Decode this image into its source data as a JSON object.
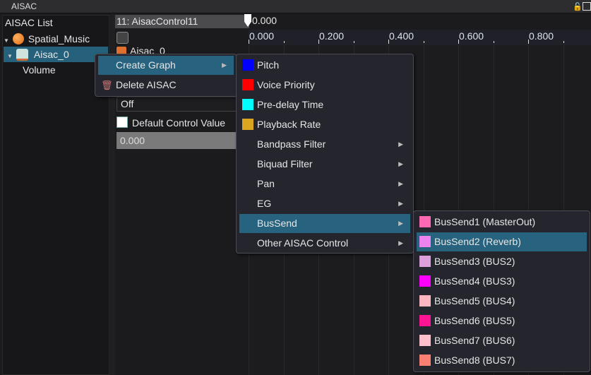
{
  "window": {
    "title": "AISAC"
  },
  "left_panel": {
    "header": "AISAC List",
    "items": [
      {
        "label": "Spatial_Music"
      },
      {
        "label": "Aisac_0"
      },
      {
        "label": "Volume"
      }
    ]
  },
  "control": {
    "name": "11: AisacControl11",
    "value": "0.000",
    "obscured_label": "Aisac_0",
    "mode": "Off",
    "default_label": "Default Control Value",
    "default_value": "0.000",
    "default_checked": false
  },
  "ruler": {
    "ticks": [
      "0.000",
      "0.200",
      "0.400",
      "0.600",
      "0.800"
    ]
  },
  "context_menu": {
    "items": [
      {
        "label": "Create Graph",
        "icon": "chevron-right"
      },
      {
        "label": "Delete AISAC",
        "icon": "trash-icon"
      }
    ]
  },
  "create_graph_menu": {
    "items": [
      {
        "label": "Pitch",
        "color": "#0000ff"
      },
      {
        "label": "Voice Priority",
        "color": "#ff0000"
      },
      {
        "label": "Pre-delay Time",
        "color": "#00ffff"
      },
      {
        "label": "Playback Rate",
        "color": "#daa520"
      },
      {
        "label": "Bandpass Filter",
        "submenu": true
      },
      {
        "label": "Biquad Filter",
        "submenu": true
      },
      {
        "label": "Pan",
        "submenu": true
      },
      {
        "label": "EG",
        "submenu": true
      },
      {
        "label": "BusSend",
        "submenu": true
      },
      {
        "label": "Other AISAC Control",
        "submenu": true
      }
    ]
  },
  "bussend_menu": {
    "items": [
      {
        "label": "BusSend1 (MasterOut)",
        "color": "#ff69b4"
      },
      {
        "label": "BusSend2 (Reverb)",
        "color": "#ee82ee"
      },
      {
        "label": "BusSend3 (BUS2)",
        "color": "#dda0dd"
      },
      {
        "label": "BusSend4 (BUS3)",
        "color": "#ff00ff"
      },
      {
        "label": "BusSend5 (BUS4)",
        "color": "#ffb6c1"
      },
      {
        "label": "BusSend6 (BUS5)",
        "color": "#ff1493"
      },
      {
        "label": "BusSend7 (BUS6)",
        "color": "#ffc0cb"
      },
      {
        "label": "BusSend8 (BUS7)",
        "color": "#fa8072"
      }
    ]
  }
}
